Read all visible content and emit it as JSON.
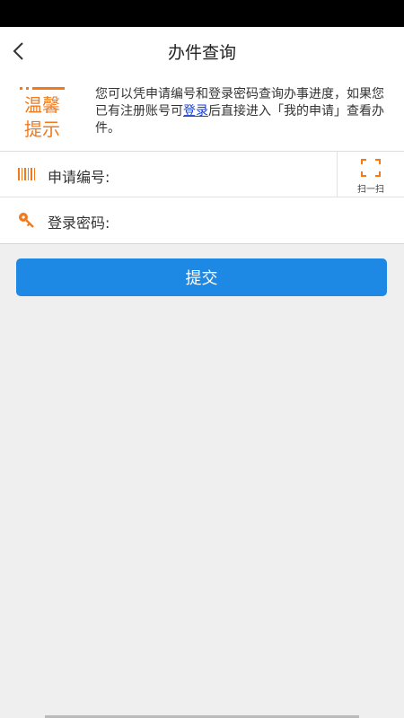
{
  "nav": {
    "title": "办件查询"
  },
  "tip": {
    "logo_line1": "温馨",
    "logo_line2": "提示",
    "text_before": "您可以凭申请编号和登录密码查询办事进度，如果您已有注册账号可",
    "link_text": "登录",
    "text_after": "后直接进入「我的申请」查看办件。"
  },
  "form": {
    "apply_no_label": "申请编号:",
    "apply_no_value": "",
    "password_label": "登录密码:",
    "password_value": "",
    "scan_label": "扫一扫"
  },
  "submit_label": "提交",
  "colors": {
    "accent": "#1e88e5",
    "orange": "#f07a1c",
    "link": "#1a3fd8"
  }
}
